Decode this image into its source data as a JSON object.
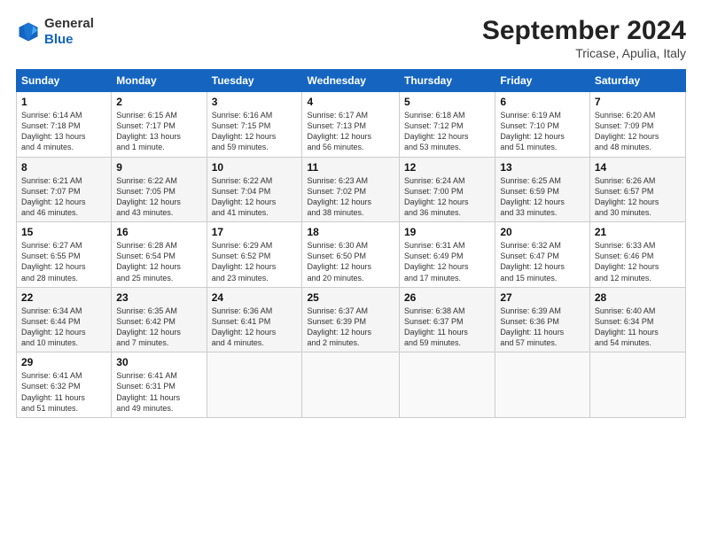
{
  "header": {
    "logo_general": "General",
    "logo_blue": "Blue",
    "month_title": "September 2024",
    "location": "Tricase, Apulia, Italy"
  },
  "weekdays": [
    "Sunday",
    "Monday",
    "Tuesday",
    "Wednesday",
    "Thursday",
    "Friday",
    "Saturday"
  ],
  "weeks": [
    [
      {
        "day": "1",
        "detail": "Sunrise: 6:14 AM\nSunset: 7:18 PM\nDaylight: 13 hours\nand 4 minutes."
      },
      {
        "day": "2",
        "detail": "Sunrise: 6:15 AM\nSunset: 7:17 PM\nDaylight: 13 hours\nand 1 minute."
      },
      {
        "day": "3",
        "detail": "Sunrise: 6:16 AM\nSunset: 7:15 PM\nDaylight: 12 hours\nand 59 minutes."
      },
      {
        "day": "4",
        "detail": "Sunrise: 6:17 AM\nSunset: 7:13 PM\nDaylight: 12 hours\nand 56 minutes."
      },
      {
        "day": "5",
        "detail": "Sunrise: 6:18 AM\nSunset: 7:12 PM\nDaylight: 12 hours\nand 53 minutes."
      },
      {
        "day": "6",
        "detail": "Sunrise: 6:19 AM\nSunset: 7:10 PM\nDaylight: 12 hours\nand 51 minutes."
      },
      {
        "day": "7",
        "detail": "Sunrise: 6:20 AM\nSunset: 7:09 PM\nDaylight: 12 hours\nand 48 minutes."
      }
    ],
    [
      {
        "day": "8",
        "detail": "Sunrise: 6:21 AM\nSunset: 7:07 PM\nDaylight: 12 hours\nand 46 minutes."
      },
      {
        "day": "9",
        "detail": "Sunrise: 6:22 AM\nSunset: 7:05 PM\nDaylight: 12 hours\nand 43 minutes."
      },
      {
        "day": "10",
        "detail": "Sunrise: 6:22 AM\nSunset: 7:04 PM\nDaylight: 12 hours\nand 41 minutes."
      },
      {
        "day": "11",
        "detail": "Sunrise: 6:23 AM\nSunset: 7:02 PM\nDaylight: 12 hours\nand 38 minutes."
      },
      {
        "day": "12",
        "detail": "Sunrise: 6:24 AM\nSunset: 7:00 PM\nDaylight: 12 hours\nand 36 minutes."
      },
      {
        "day": "13",
        "detail": "Sunrise: 6:25 AM\nSunset: 6:59 PM\nDaylight: 12 hours\nand 33 minutes."
      },
      {
        "day": "14",
        "detail": "Sunrise: 6:26 AM\nSunset: 6:57 PM\nDaylight: 12 hours\nand 30 minutes."
      }
    ],
    [
      {
        "day": "15",
        "detail": "Sunrise: 6:27 AM\nSunset: 6:55 PM\nDaylight: 12 hours\nand 28 minutes."
      },
      {
        "day": "16",
        "detail": "Sunrise: 6:28 AM\nSunset: 6:54 PM\nDaylight: 12 hours\nand 25 minutes."
      },
      {
        "day": "17",
        "detail": "Sunrise: 6:29 AM\nSunset: 6:52 PM\nDaylight: 12 hours\nand 23 minutes."
      },
      {
        "day": "18",
        "detail": "Sunrise: 6:30 AM\nSunset: 6:50 PM\nDaylight: 12 hours\nand 20 minutes."
      },
      {
        "day": "19",
        "detail": "Sunrise: 6:31 AM\nSunset: 6:49 PM\nDaylight: 12 hours\nand 17 minutes."
      },
      {
        "day": "20",
        "detail": "Sunrise: 6:32 AM\nSunset: 6:47 PM\nDaylight: 12 hours\nand 15 minutes."
      },
      {
        "day": "21",
        "detail": "Sunrise: 6:33 AM\nSunset: 6:46 PM\nDaylight: 12 hours\nand 12 minutes."
      }
    ],
    [
      {
        "day": "22",
        "detail": "Sunrise: 6:34 AM\nSunset: 6:44 PM\nDaylight: 12 hours\nand 10 minutes."
      },
      {
        "day": "23",
        "detail": "Sunrise: 6:35 AM\nSunset: 6:42 PM\nDaylight: 12 hours\nand 7 minutes."
      },
      {
        "day": "24",
        "detail": "Sunrise: 6:36 AM\nSunset: 6:41 PM\nDaylight: 12 hours\nand 4 minutes."
      },
      {
        "day": "25",
        "detail": "Sunrise: 6:37 AM\nSunset: 6:39 PM\nDaylight: 12 hours\nand 2 minutes."
      },
      {
        "day": "26",
        "detail": "Sunrise: 6:38 AM\nSunset: 6:37 PM\nDaylight: 11 hours\nand 59 minutes."
      },
      {
        "day": "27",
        "detail": "Sunrise: 6:39 AM\nSunset: 6:36 PM\nDaylight: 11 hours\nand 57 minutes."
      },
      {
        "day": "28",
        "detail": "Sunrise: 6:40 AM\nSunset: 6:34 PM\nDaylight: 11 hours\nand 54 minutes."
      }
    ],
    [
      {
        "day": "29",
        "detail": "Sunrise: 6:41 AM\nSunset: 6:32 PM\nDaylight: 11 hours\nand 51 minutes."
      },
      {
        "day": "30",
        "detail": "Sunrise: 6:41 AM\nSunset: 6:31 PM\nDaylight: 11 hours\nand 49 minutes."
      },
      {
        "day": "",
        "detail": ""
      },
      {
        "day": "",
        "detail": ""
      },
      {
        "day": "",
        "detail": ""
      },
      {
        "day": "",
        "detail": ""
      },
      {
        "day": "",
        "detail": ""
      }
    ]
  ]
}
